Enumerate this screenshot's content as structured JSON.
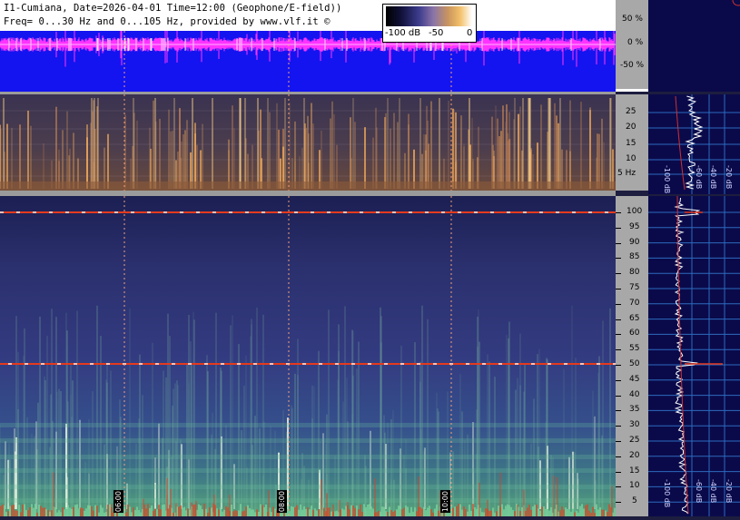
{
  "header": {
    "line1": "I1-Cumiana, Date=2026-04-01 Time=12:00 (Geophone/E-field))",
    "line2": "Freq= 0...30 Hz and 0...105 Hz, provided by www.vlf.it ©"
  },
  "colorbar": {
    "label_left": "-100 dB",
    "label_mid": "-50",
    "label_right": "0"
  },
  "waveform_scale": [
    "50 %",
    "0 %",
    "-50 %"
  ],
  "spec1_scale": [
    "25",
    "20",
    "15",
    "10",
    "5 Hz"
  ],
  "spec2_scale": [
    "100",
    "95",
    "90",
    "85",
    "80",
    "75",
    "70",
    "65",
    "60",
    "55",
    "50",
    "45",
    "40",
    "35",
    "30",
    "25",
    "20",
    "15",
    "10",
    "5"
  ],
  "side_panel_top": {
    "db_labels": [
      "-100 dB",
      "-60 dB",
      "-40 dB",
      "-20 dB"
    ]
  },
  "side_panel_bottom": {
    "db_labels": [
      "-100 dB",
      "-60 dB",
      "-40 dB",
      "-20 dB"
    ]
  },
  "time_labels": [
    "06:00",
    "08:00",
    "10:00"
  ],
  "colors": {
    "waveform_bg": "#1414f0",
    "waveform_trace": "#ff33ff",
    "mains_line": "#e63a1e",
    "grid_dash": "#f5a07a"
  }
}
